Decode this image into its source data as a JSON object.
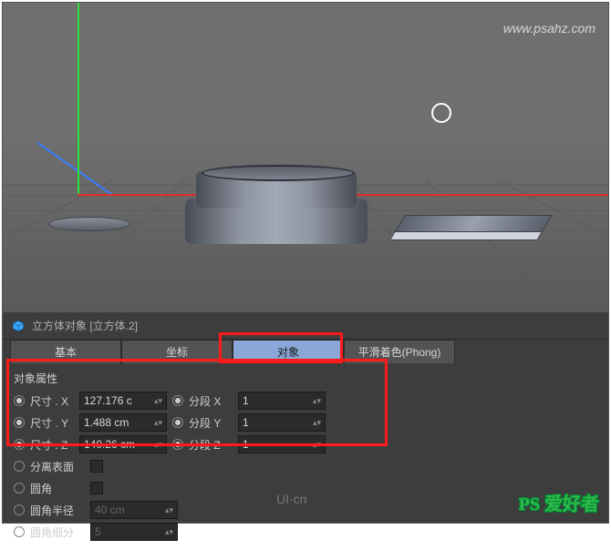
{
  "header": {
    "object_title": "立方体对象 [立方体.2]"
  },
  "tabs": [
    {
      "label": "基本"
    },
    {
      "label": "坐标"
    },
    {
      "label": "对象",
      "active": true
    },
    {
      "label": "平滑着色(Phong)"
    }
  ],
  "props": {
    "section_title": "对象属性",
    "size_x_label": "尺寸 . X",
    "size_x_value": "127.176 c",
    "seg_x_label": "分段 X",
    "seg_x_value": "1",
    "size_y_label": "尺寸 . Y",
    "size_y_value": "1.488 cm",
    "seg_y_label": "分段 Y",
    "seg_y_value": "1",
    "size_z_label": "尺寸 . Z",
    "size_z_value": "140.26 cm",
    "seg_z_label": "分段 Z",
    "seg_z_value": "1",
    "separate_label": "分离表面",
    "fillet_label": "圆角",
    "fillet_radius_label": "圆角半径",
    "fillet_radius_value": "40 cm",
    "fillet_sub_label": "圆角细分",
    "fillet_sub_value": "5"
  },
  "watermarks": {
    "top_right": "www.psahz.com",
    "bottom_center": "UI·cn",
    "bottom_right": "PS 爱好者"
  }
}
